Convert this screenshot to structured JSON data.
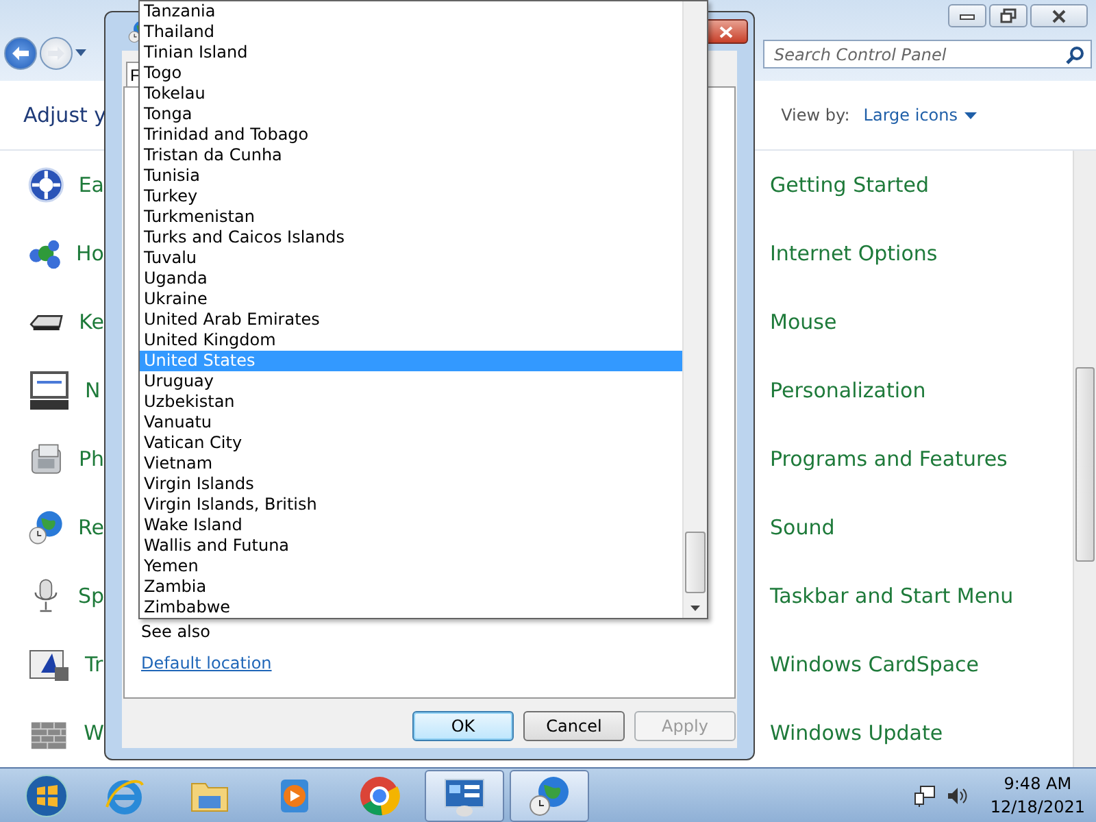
{
  "control_panel": {
    "search": {
      "placeholder": "Search Control Panel"
    },
    "heading": "Adjust y",
    "view_by": {
      "label": "View by:",
      "value": "Large icons"
    },
    "items_left": [
      {
        "label": "Ea"
      },
      {
        "label": "Ho"
      },
      {
        "label": "Ke"
      },
      {
        "label": "N"
      },
      {
        "label": "Ph"
      },
      {
        "label": "Re"
      },
      {
        "label": "Sp"
      },
      {
        "label": "Tr"
      },
      {
        "label": "W"
      }
    ],
    "items_right": [
      {
        "label": "Getting Started"
      },
      {
        "label": "Internet Options"
      },
      {
        "label": "Mouse"
      },
      {
        "label": "Personalization"
      },
      {
        "label": "Programs and Features"
      },
      {
        "label": "Sound"
      },
      {
        "label": "Taskbar and Start Menu"
      },
      {
        "label": "Windows CardSpace"
      },
      {
        "label": "Windows Update"
      }
    ]
  },
  "dialog": {
    "tab": {
      "label": "F",
      "selected": true
    },
    "see_also": "See also",
    "link": "Default location",
    "buttons": [
      {
        "label": "OK",
        "kind": "default",
        "disabled": false
      },
      {
        "label": "Cancel",
        "kind": "normal",
        "disabled": false
      },
      {
        "label": "Apply",
        "kind": "normal",
        "disabled": true
      }
    ]
  },
  "dropdown": {
    "items": [
      {
        "label": "Tanzania",
        "selected": false
      },
      {
        "label": "Thailand",
        "selected": false
      },
      {
        "label": "Tinian Island",
        "selected": false
      },
      {
        "label": "Togo",
        "selected": false
      },
      {
        "label": "Tokelau",
        "selected": false
      },
      {
        "label": "Tonga",
        "selected": false
      },
      {
        "label": "Trinidad and Tobago",
        "selected": false
      },
      {
        "label": "Tristan da Cunha",
        "selected": false
      },
      {
        "label": "Tunisia",
        "selected": false
      },
      {
        "label": "Turkey",
        "selected": false
      },
      {
        "label": "Turkmenistan",
        "selected": false
      },
      {
        "label": "Turks and Caicos Islands",
        "selected": false
      },
      {
        "label": "Tuvalu",
        "selected": false
      },
      {
        "label": "Uganda",
        "selected": false
      },
      {
        "label": "Ukraine",
        "selected": false
      },
      {
        "label": "United Arab Emirates",
        "selected": false
      },
      {
        "label": "United Kingdom",
        "selected": false
      },
      {
        "label": "United States",
        "selected": true
      },
      {
        "label": "Uruguay",
        "selected": false
      },
      {
        "label": "Uzbekistan",
        "selected": false
      },
      {
        "label": "Vanuatu",
        "selected": false
      },
      {
        "label": "Vatican City",
        "selected": false
      },
      {
        "label": "Vietnam",
        "selected": false
      },
      {
        "label": "Virgin Islands",
        "selected": false
      },
      {
        "label": "Virgin Islands, British",
        "selected": false
      },
      {
        "label": "Wake Island",
        "selected": false
      },
      {
        "label": "Wallis and Futuna",
        "selected": false
      },
      {
        "label": "Yemen",
        "selected": false
      },
      {
        "label": "Zambia",
        "selected": false
      },
      {
        "label": "Zimbabwe",
        "selected": false
      }
    ]
  },
  "taskbar": {
    "apps": [
      {
        "active": false
      },
      {
        "active": false
      },
      {
        "active": false
      },
      {
        "active": false
      },
      {
        "active": false
      },
      {
        "active": true
      },
      {
        "active": true
      }
    ],
    "clock": {
      "time": "9:48 AM",
      "date": "12/18/2021"
    }
  }
}
